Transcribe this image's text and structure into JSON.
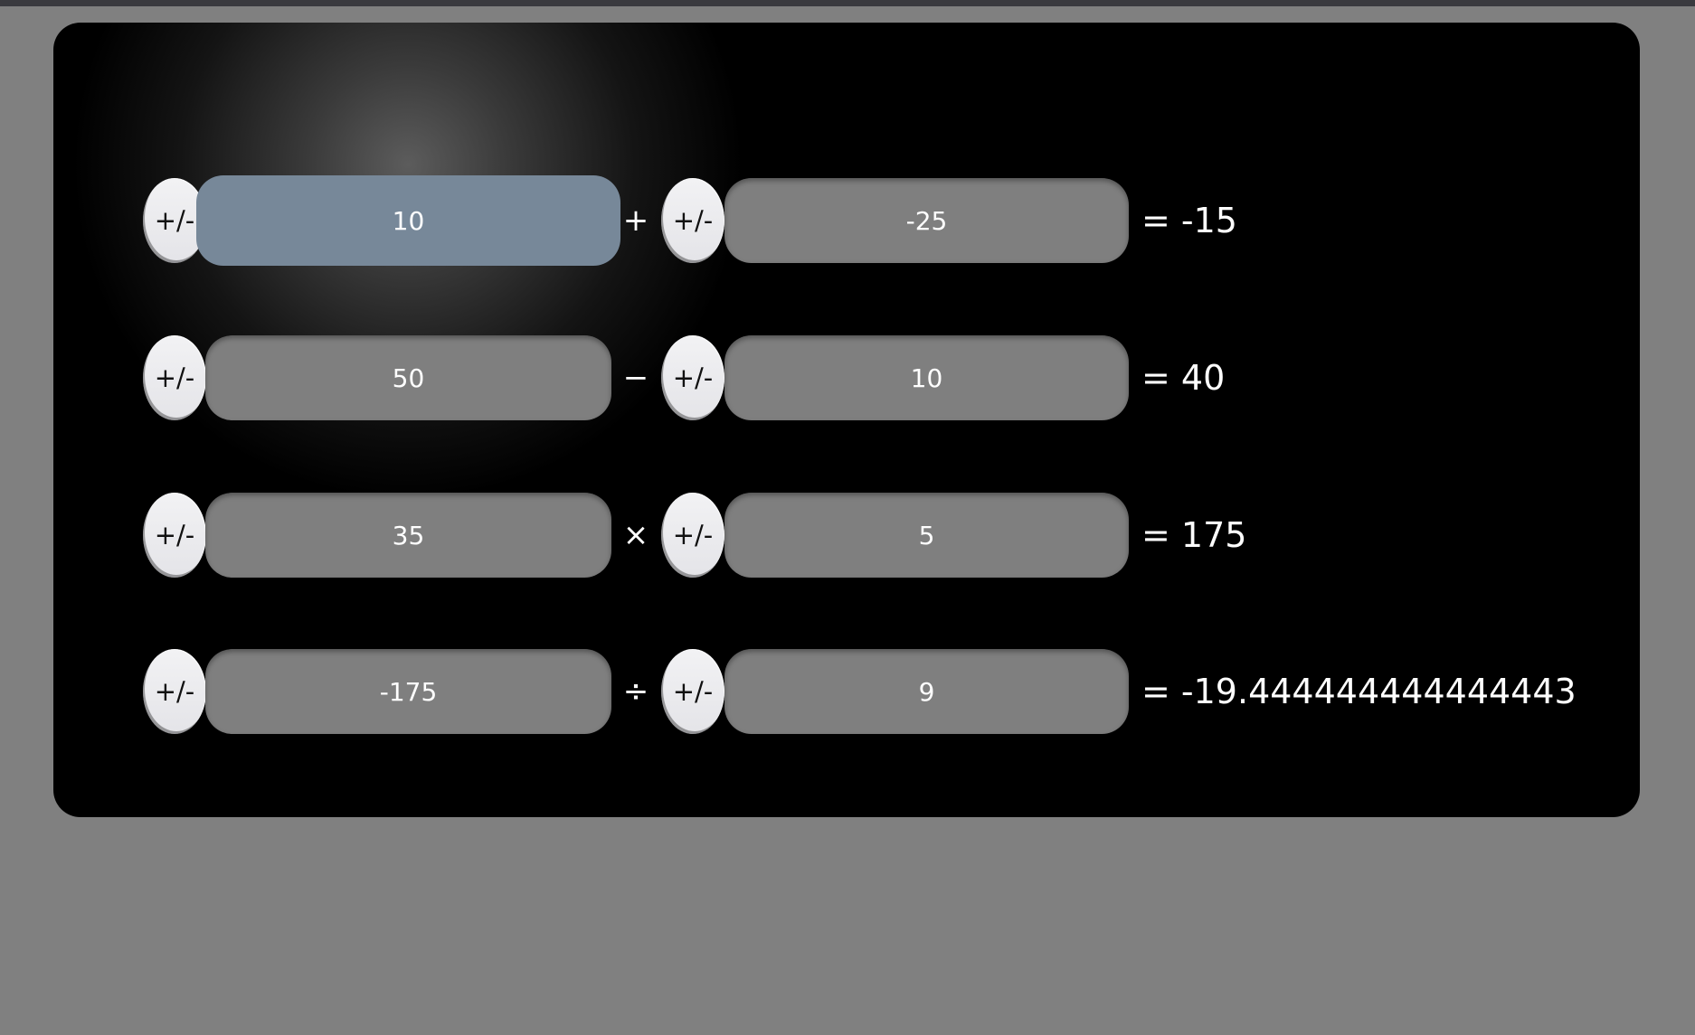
{
  "sign_toggle_label": "+/-",
  "rows": [
    {
      "left": "10",
      "operator": "+",
      "right": "-25",
      "result": "= -15"
    },
    {
      "left": "50",
      "operator": "−",
      "right": "10",
      "result": "= 40"
    },
    {
      "left": "35",
      "operator": "×",
      "right": "5",
      "result": "= 175"
    },
    {
      "left": "-175",
      "operator": "÷",
      "right": "9",
      "result": "= -19.444444444444443"
    }
  ],
  "colors": {
    "page_background": "#808080",
    "panel_background": "#000000",
    "input_background": "#7f7f7f",
    "focused_input_background": "#778899",
    "text": "#ffffff"
  }
}
